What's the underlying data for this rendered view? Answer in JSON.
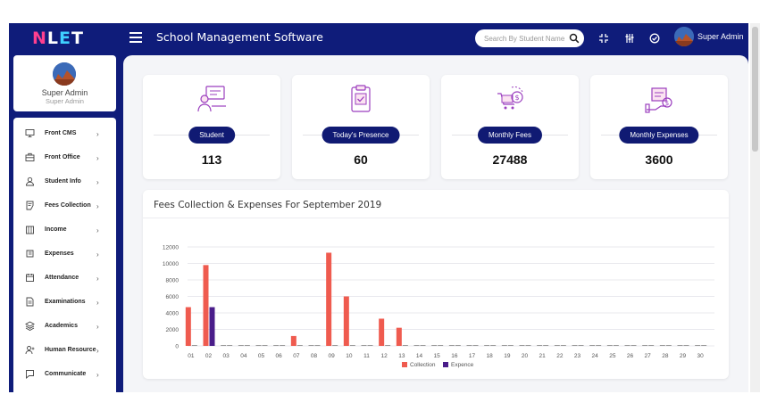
{
  "topbar": {
    "logo": {
      "n": "N",
      "mid": "L",
      "e": "E",
      "end": "T"
    },
    "title": "School Management Software",
    "search_placeholder": "Search By Student Name",
    "user_name": "Super Admin"
  },
  "profile": {
    "name": "Super Admin",
    "role": "Super Admin"
  },
  "sidebar": {
    "items": [
      {
        "label": "Front CMS",
        "icon": "monitor-icon"
      },
      {
        "label": "Front Office",
        "icon": "briefcase-icon"
      },
      {
        "label": "Student Info",
        "icon": "user-icon"
      },
      {
        "label": "Fees Collection",
        "icon": "document-icon"
      },
      {
        "label": "Income",
        "icon": "building-icon"
      },
      {
        "label": "Expenses",
        "icon": "wallet-icon"
      },
      {
        "label": "Attendance",
        "icon": "calendar-icon"
      },
      {
        "label": "Examinations",
        "icon": "file-icon"
      },
      {
        "label": "Academics",
        "icon": "layers-icon"
      },
      {
        "label": "Human Resource",
        "icon": "user-plus-icon"
      },
      {
        "label": "Communicate",
        "icon": "chat-icon"
      }
    ]
  },
  "stats": [
    {
      "label": "Student",
      "value": "113",
      "icon": "student-computer-icon"
    },
    {
      "label": "Today's Presence",
      "value": "60",
      "icon": "clipboard-check-icon"
    },
    {
      "label": "Monthly Fees",
      "value": "27488",
      "icon": "cart-coin-icon"
    },
    {
      "label": "Monthly Expenses",
      "value": "3600",
      "icon": "hand-basket-icon"
    }
  ],
  "chart_title": "Fees Collection & Expenses For September 2019",
  "colors": {
    "collection": "#ef5b4f",
    "expense": "#4a1d8a",
    "brand": "#101a73"
  },
  "chart_data": {
    "type": "bar",
    "title": "Fees Collection & Expenses For September 2019",
    "categories": [
      "01",
      "02",
      "03",
      "04",
      "05",
      "06",
      "07",
      "08",
      "09",
      "10",
      "11",
      "12",
      "13",
      "14",
      "15",
      "16",
      "17",
      "18",
      "19",
      "20",
      "21",
      "22",
      "23",
      "24",
      "25",
      "26",
      "27",
      "28",
      "29",
      "30"
    ],
    "series": [
      {
        "name": "Collection",
        "values": [
          4700,
          9800,
          0,
          0,
          0,
          0,
          1200,
          0,
          11300,
          6000,
          0,
          3300,
          2200,
          0,
          0,
          0,
          0,
          0,
          0,
          0,
          0,
          0,
          0,
          0,
          0,
          0,
          0,
          0,
          0,
          0
        ]
      },
      {
        "name": "Expence",
        "values": [
          0,
          4700,
          0,
          0,
          0,
          0,
          0,
          0,
          0,
          0,
          0,
          0,
          0,
          0,
          0,
          0,
          0,
          0,
          0,
          0,
          0,
          0,
          0,
          0,
          0,
          0,
          0,
          0,
          0,
          0
        ]
      }
    ],
    "y_ticks": [
      "0",
      "2000",
      "4000",
      "6000",
      "8000",
      "10000",
      "12000"
    ],
    "ylim": [
      0,
      12000
    ],
    "grid": true,
    "legend": "bottom-center"
  }
}
